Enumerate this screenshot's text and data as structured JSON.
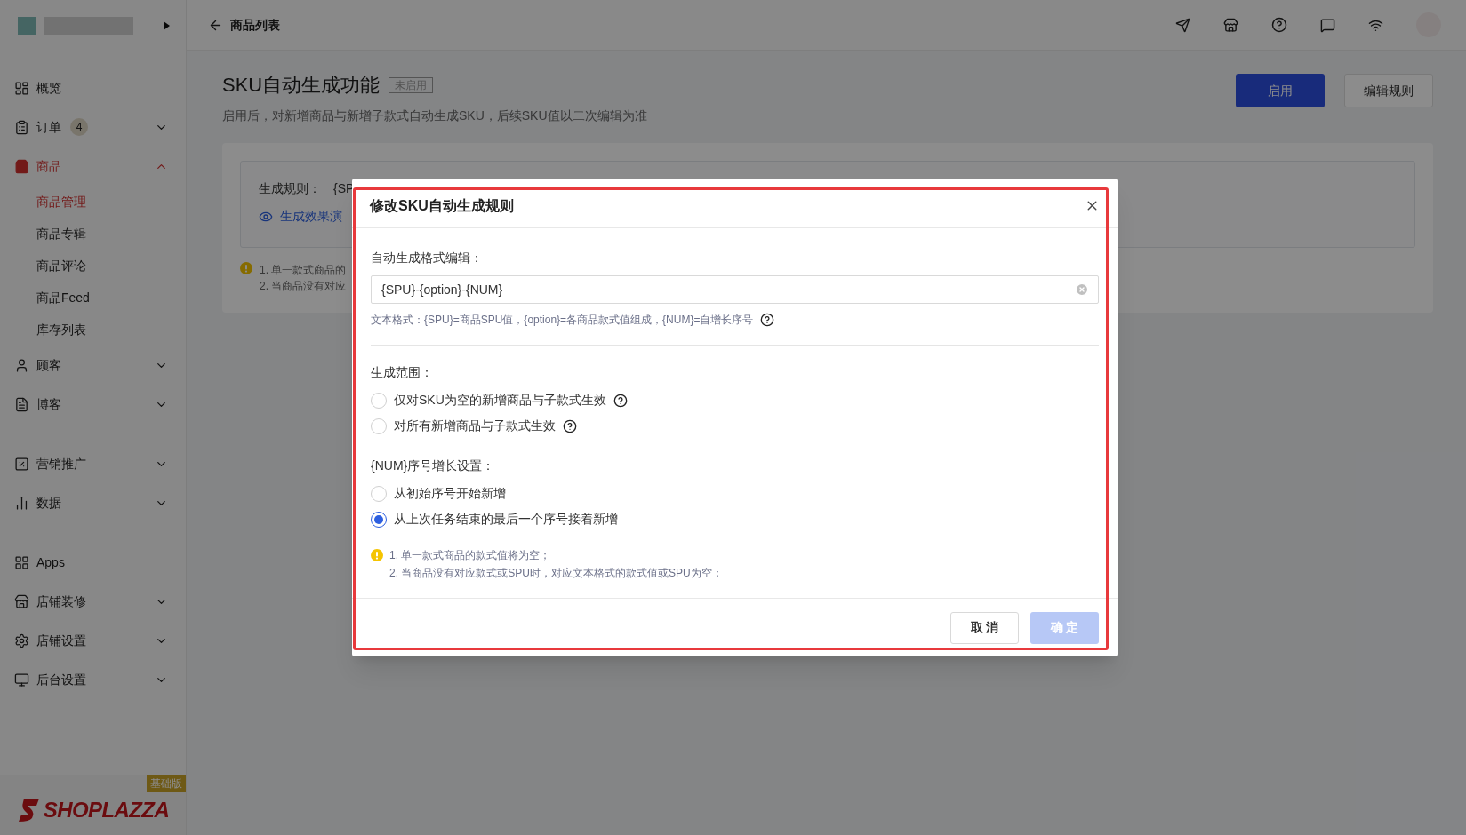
{
  "header": {
    "title": "商品列表"
  },
  "sidebar": {
    "sections": [
      [
        {
          "label": "概览",
          "kind": "link",
          "selected": false
        },
        {
          "label": "订单",
          "kind": "group",
          "badge": "4",
          "expanded": false,
          "selected": false
        },
        {
          "label": "商品",
          "kind": "group",
          "expanded": true,
          "selected": true,
          "children": [
            {
              "label": "商品管理",
              "selected": true
            },
            {
              "label": "商品专辑",
              "selected": false
            },
            {
              "label": "商品评论",
              "selected": false
            },
            {
              "label": "商品Feed",
              "selected": false
            },
            {
              "label": "库存列表",
              "selected": false
            }
          ]
        },
        {
          "label": "顾客",
          "kind": "group",
          "expanded": false,
          "selected": false
        },
        {
          "label": "博客",
          "kind": "group",
          "expanded": false,
          "selected": false
        }
      ],
      [
        {
          "label": "营销推广",
          "kind": "group",
          "expanded": false,
          "selected": false
        },
        {
          "label": "数据",
          "kind": "group",
          "expanded": false,
          "selected": false
        }
      ],
      [
        {
          "label": "Apps",
          "kind": "link",
          "selected": false
        },
        {
          "label": "店铺装修",
          "kind": "group",
          "expanded": false,
          "selected": false
        },
        {
          "label": "店铺设置",
          "kind": "group",
          "expanded": false,
          "selected": false
        },
        {
          "label": "后台设置",
          "kind": "group",
          "expanded": false,
          "selected": false
        }
      ]
    ],
    "plan_badge": "基础版",
    "logo": "SHOPLAZZA"
  },
  "page": {
    "title": "SKU自动生成功能",
    "status_tag": "未启用",
    "subtitle": "启用后，对新增商品与新增子款式自动生成SKU，后续SKU值以二次编辑为准",
    "buttons": [
      {
        "label": "启用",
        "kind": "primary"
      },
      {
        "label": "编辑规则",
        "kind": "default"
      }
    ],
    "rule_label": "生成规则：",
    "rule_value": "{SP",
    "demo_link": "生成效果演",
    "notes": [
      "1. 单一款式商品的",
      "2. 当商品没有对应"
    ]
  },
  "dialog": {
    "title": "修改SKU自动生成规则",
    "format_label": "自动生成格式编辑：",
    "format_value": "{SPU}-{option}-{NUM}",
    "format_hint": "文本格式：{SPU}=商品SPU值，{option}=各商品款式值组成，{NUM}=自增长序号",
    "groups": [
      {
        "label": "生成范围：",
        "options": [
          {
            "label": "仅对SKU为空的新增商品与子款式生效",
            "selected": false,
            "help": true
          },
          {
            "label": "对所有新增商品与子款式生效",
            "selected": false,
            "help": true
          }
        ]
      },
      {
        "label": "{NUM}序号增长设置：",
        "options": [
          {
            "label": "从初始序号开始新增",
            "selected": false,
            "help": false
          },
          {
            "label": "从上次任务结束的最后一个序号接着新增",
            "selected": true,
            "help": false
          }
        ]
      }
    ],
    "notes": [
      "1. 单一款式商品的款式值将为空；",
      "2. 当商品没有对应款式或SPU时，对应文本格式的款式值或SPU为空；"
    ],
    "buttons": [
      {
        "label": "取 消",
        "kind": "default",
        "disabled": false
      },
      {
        "label": "确 定",
        "kind": "primary",
        "disabled": true
      }
    ]
  }
}
